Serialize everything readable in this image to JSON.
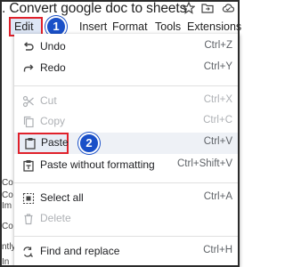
{
  "document": {
    "title": ". Convert google doc to sheets"
  },
  "menubar": {
    "items": [
      {
        "label": "Edit"
      },
      {
        "label": "Insert"
      },
      {
        "label": "Format"
      },
      {
        "label": "Tools"
      },
      {
        "label": "Extensions"
      }
    ]
  },
  "callouts": {
    "step1": "1",
    "step2": "2"
  },
  "background_fragments": [
    "Co",
    "Co",
    "Im",
    "Co",
    "ntly",
    "In"
  ],
  "edit_menu": {
    "items": [
      {
        "label": "Undo",
        "shortcut": "Ctrl+Z",
        "icon": "undo-icon",
        "enabled": true
      },
      {
        "label": "Redo",
        "shortcut": "Ctrl+Y",
        "icon": "redo-icon",
        "enabled": true
      },
      {
        "label": "Cut",
        "shortcut": "Ctrl+X",
        "icon": "cut-icon",
        "enabled": false
      },
      {
        "label": "Copy",
        "shortcut": "Ctrl+C",
        "icon": "copy-icon",
        "enabled": false
      },
      {
        "label": "Paste",
        "shortcut": "Ctrl+V",
        "icon": "paste-icon",
        "enabled": true,
        "highlighted": true
      },
      {
        "label": "Paste without formatting",
        "shortcut": "Ctrl+Shift+V",
        "icon": "paste-plain-icon",
        "enabled": true
      },
      {
        "label": "Select all",
        "shortcut": "Ctrl+A",
        "icon": "select-all-icon",
        "enabled": true
      },
      {
        "label": "Delete",
        "shortcut": "",
        "icon": "delete-icon",
        "enabled": false
      },
      {
        "label": "Find and replace",
        "shortcut": "Ctrl+H",
        "icon": "find-replace-icon",
        "enabled": true
      }
    ]
  },
  "colors": {
    "highlight_border": "#e0212b",
    "badge": "#1a50c8",
    "disabled_text": "#aeb1b5"
  }
}
